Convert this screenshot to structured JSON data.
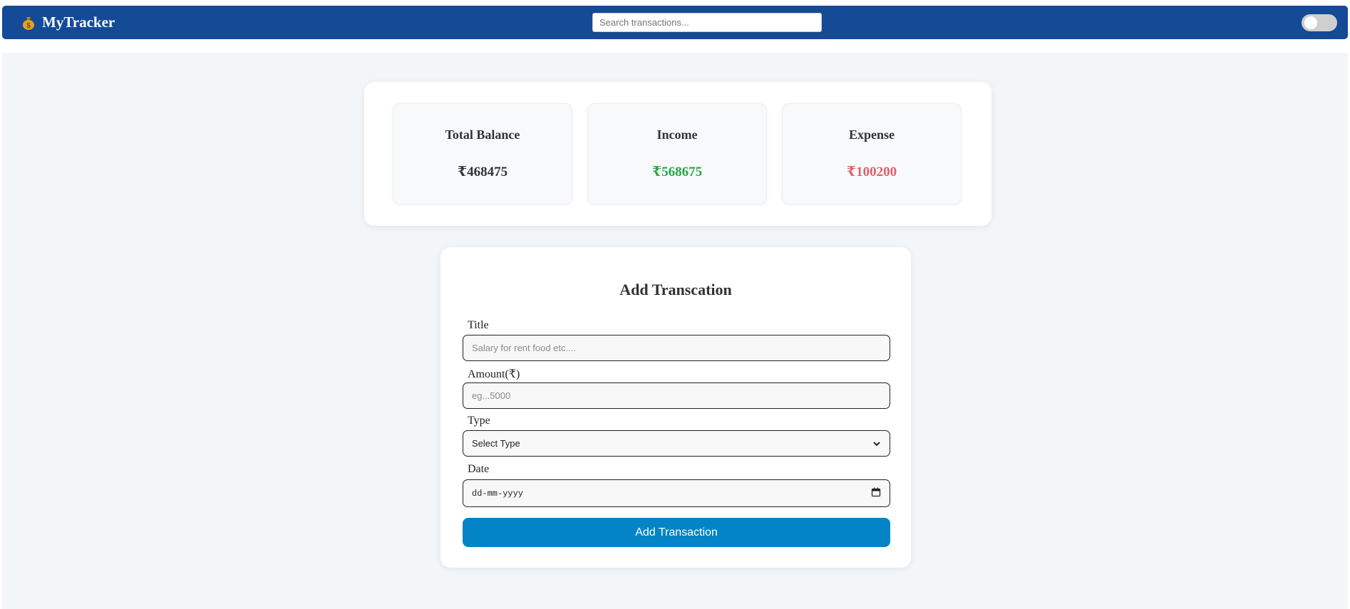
{
  "navbar": {
    "brand_icon": "money-bag-icon",
    "brand_name": "MyTracker",
    "search_placeholder": "Search transactions...",
    "theme_toggle": "off"
  },
  "summary": {
    "cards": [
      {
        "title": "Total Balance",
        "value": "₹468475",
        "color": "#333333"
      },
      {
        "title": "Income",
        "value": "₹568675",
        "color": "#28a745"
      },
      {
        "title": "Expense",
        "value": "₹100200",
        "color": "#e35d6a"
      }
    ]
  },
  "form": {
    "heading": "Add Transcation",
    "title_label": "Title",
    "title_placeholder": "Salary for rent food etc....",
    "amount_label": "Amount(₹)",
    "amount_placeholder": "eg...5000",
    "type_label": "Type",
    "type_selected": "Select Type",
    "date_label": "Date",
    "date_placeholder": "dd-mm-yyyy",
    "submit_label": "Add Transaction"
  },
  "colors": {
    "navbar": "#144a96",
    "accent_button": "#0284c7",
    "income": "#28a745",
    "expense": "#e35d6a",
    "page_background": "#f3f6f9"
  }
}
